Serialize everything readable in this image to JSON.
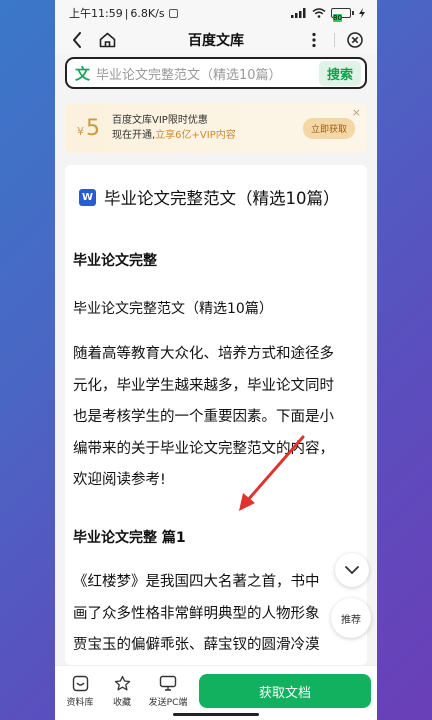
{
  "status_bar": {
    "time": "上午11:59",
    "speed": "6.8K/s",
    "battery": "80"
  },
  "nav": {
    "title": "百度文库"
  },
  "search": {
    "logo": "文",
    "query": "毕业论文完整范文（精选10篇）",
    "button": "搜索"
  },
  "vip": {
    "yen": "¥",
    "price": "5",
    "title": "百度文库VIP限时优惠",
    "sub_prefix": "现在开通,",
    "sub_highlight": "立享6亿+VIP内容",
    "button": "立即获取",
    "close": "×"
  },
  "doc": {
    "icon_letter": "W",
    "title": "毕业论文完整范文（精选10篇）",
    "heading1": "毕业论文完整",
    "subtitle": "毕业论文完整范文（精选10篇）",
    "para_lines": [
      "随着高等教育大众化、培养方式和途径多",
      "元化，毕业学生越来越多，毕业论文同时",
      "也是考核学生的一个重要因素。下面是小",
      "编带来的关于毕业论文完整范文的内容，",
      "欢迎阅读参考!"
    ],
    "heading2": "毕业论文完整 篇1",
    "para2_lines": [
      "《红楼梦》是我国四大名著之首，书中",
      "画了众多性格非常鲜明典型的人物形象",
      "贾宝玉的偏僻乖张、薛宝钗的圆滑冷漠"
    ]
  },
  "floating": {
    "recommend": "推荐"
  },
  "bottom": {
    "items": [
      "资料库",
      "收藏",
      "发送PC端"
    ],
    "cta": "获取文档"
  },
  "colors": {
    "accent_green": "#12b15f",
    "vip_gold": "#c99a4a",
    "annotation_red": "#e0332e"
  }
}
